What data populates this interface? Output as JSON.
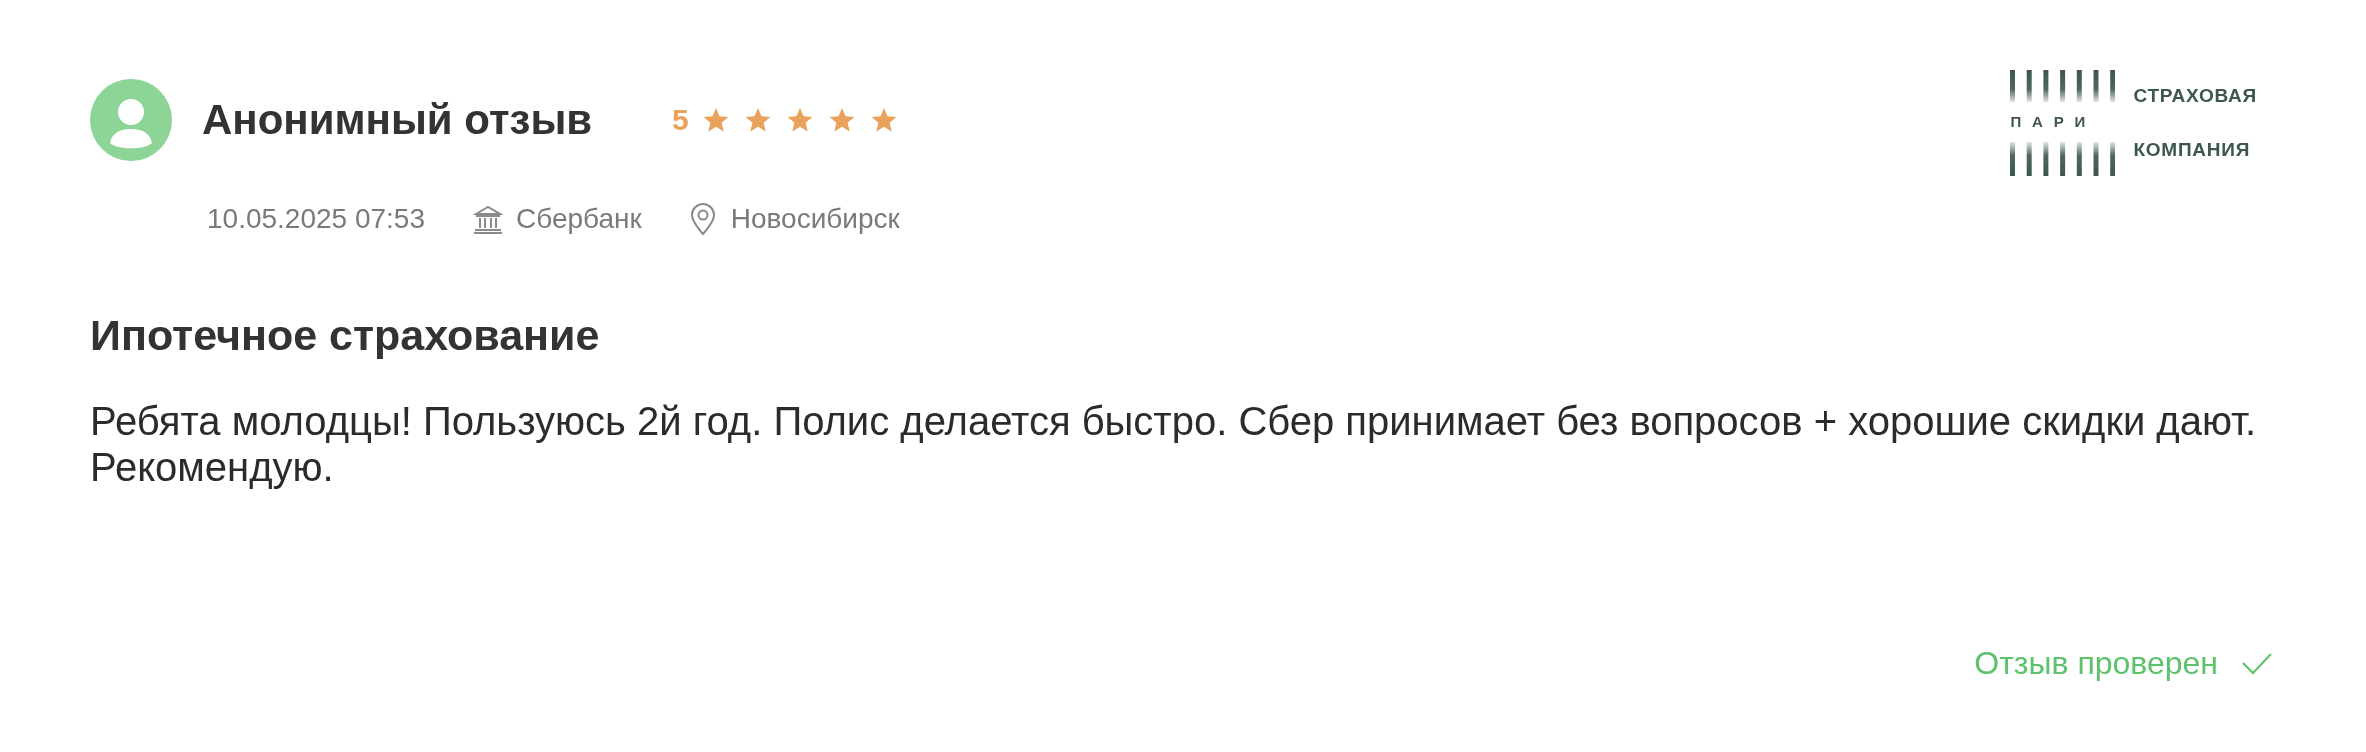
{
  "review": {
    "author": "Анонимный отзыв",
    "rating": {
      "score": "5",
      "stars": 5
    },
    "date": "10.05.2025 07:53",
    "bank": "Сбербанк",
    "city": "Новосибирск",
    "company_logo": {
      "brand": "ПАРИ",
      "line_1": "СТРАХОВАЯ",
      "line_2": "КОМПАНИЯ"
    },
    "title": "Ипотечное страхование",
    "text": "Ребята молодцы! Пользуюсь 2й год. Полис делается быстро. Сбер принимает без вопросов + хорошие скидки дают. Рекомендую.",
    "verification": {
      "label": "Отзыв проверен",
      "verified": true
    }
  }
}
